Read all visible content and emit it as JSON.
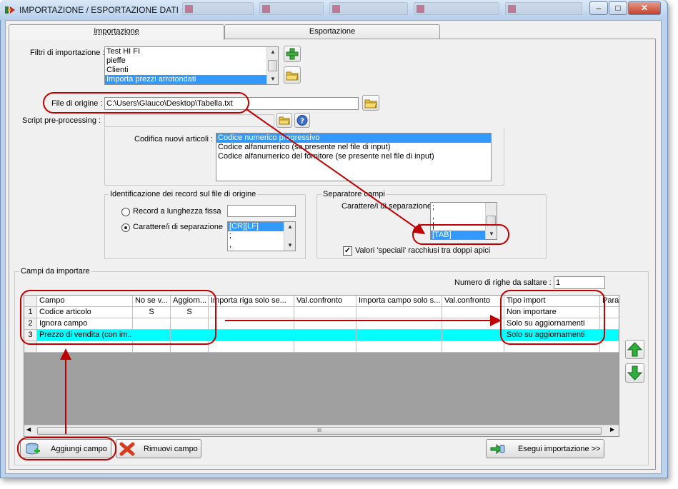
{
  "window": {
    "title": "IMPORTAZIONE / ESPORTAZIONE DATI",
    "controls": [
      "minimize",
      "maximize",
      "close"
    ]
  },
  "tabs": [
    {
      "label": "Importazione",
      "active": true
    },
    {
      "label": "Esportazione",
      "active": false
    }
  ],
  "import": {
    "filters_label": "Filtri di importazione :",
    "filters": [
      "Test HI FI",
      "pieffe",
      "Clienti",
      "Importa prezzi arrotondati"
    ],
    "filters_selected": "Importa prezzi arrotondati",
    "source_file_label": "File di origine :",
    "source_file_value": "C:\\Users\\Glauco\\Desktop\\Tabella.txt",
    "script_label": "Script pre-processing :",
    "script_value": "",
    "coding_label": "Codifica nuovi articoli :",
    "coding_options": [
      "Codice numerico progressivo",
      "Codice alfanumerico (se presente nel file di input)",
      "Codice alfanumerico del fornitore (se presente nel file di input)"
    ],
    "coding_selected": "Codice numerico progressivo",
    "record_id": {
      "title": "Identificazione dei record sul file di origine",
      "fixed_length_label": "Record a lunghezza fissa",
      "separator_label": "Carattere/i di separazione",
      "selected": "separator",
      "fixed_length_value": "",
      "separator_options": [
        "[CR][LF]",
        ";",
        ","
      ]
    },
    "field_separator": {
      "title": "Separatore campi",
      "label": "Carattere/i di separazione",
      "options": [
        ";",
        ",",
        "|",
        "[TAB]"
      ],
      "selected": "[TAB]",
      "special_values_label": "Valori 'speciali' racchiusi tra doppi apici",
      "special_values_checked": true
    },
    "fields": {
      "title": "Campi da importare",
      "skip_rows_label": "Numero di righe da saltare :",
      "skip_rows_value": "1",
      "columns": [
        "Campo",
        "No se v...",
        "Aggiorn...",
        "Importa riga solo se...",
        "Val.confronto",
        "Importa campo solo s...",
        "Val.confronto",
        "Tipo import",
        "Para"
      ],
      "rows": [
        {
          "num": "1",
          "cells": [
            "Codice articolo",
            "S",
            "S",
            "",
            "",
            "",
            "",
            "Non importare",
            ""
          ]
        },
        {
          "num": "2",
          "cells": [
            "Ignora campo",
            "",
            "",
            "",
            "",
            "",
            "",
            "Solo su aggiornamenti",
            ""
          ]
        },
        {
          "num": "3",
          "cells": [
            "Prezzo di vendita (con im...",
            "",
            "",
            "",
            "",
            "",
            "",
            "Solo su aggiornamenti",
            ""
          ]
        }
      ],
      "hscroll_grip": "III"
    },
    "buttons": {
      "add_field": "Aggiungi campo",
      "remove_field": "Rimuovi campo",
      "run_import": "Esegui importazione >>"
    }
  },
  "colors": {
    "title_bar": "#c7dbf2",
    "selection": "#3399ff",
    "highlight_row": "#00ffff",
    "annotation": "#c00000",
    "grid_background": "#a0a0a0"
  }
}
